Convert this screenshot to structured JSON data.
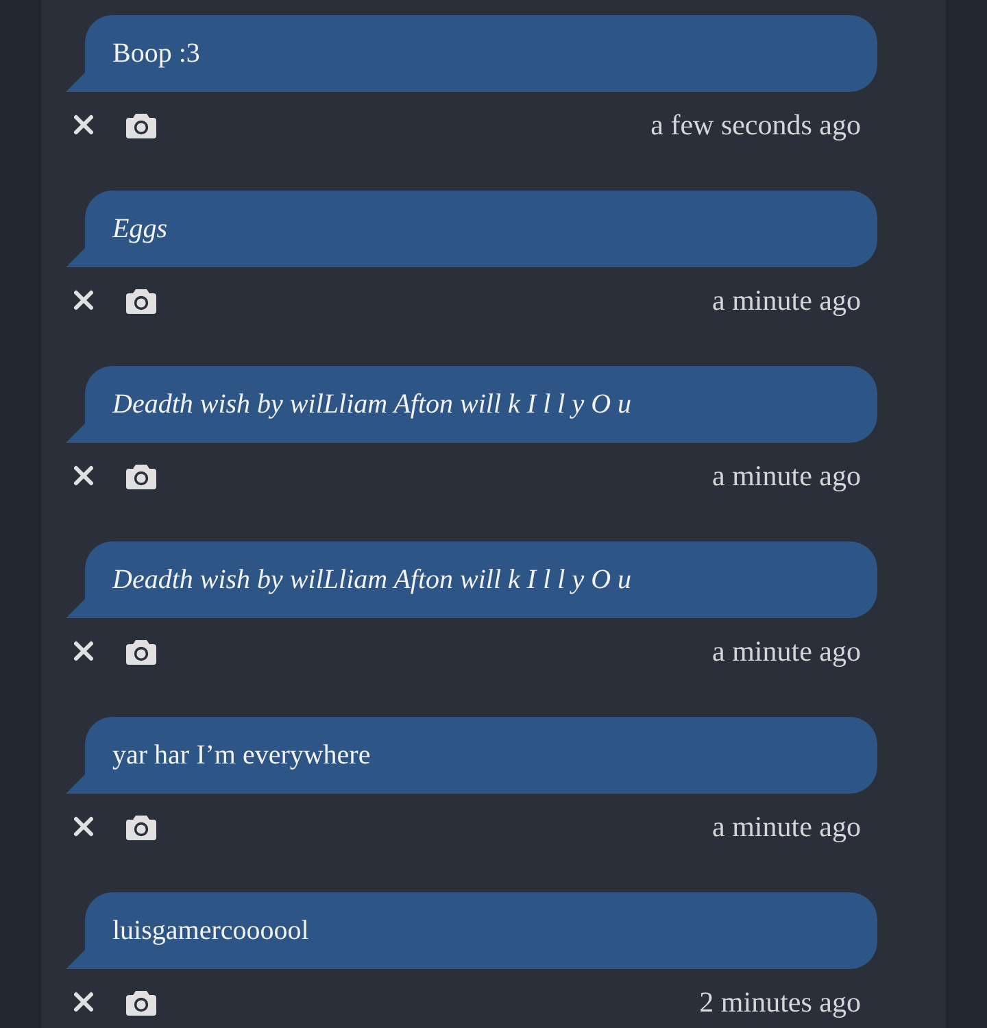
{
  "messages": [
    {
      "text": "Boop :3",
      "italic": false,
      "time": "a few seconds ago"
    },
    {
      "text": "Eggs",
      "italic": true,
      "time": "a minute ago"
    },
    {
      "text": "Deadth wish by wilLliam Afton will k I l l y O u",
      "italic": true,
      "time": "a minute ago"
    },
    {
      "text": "Deadth wish by wilLliam Afton will k I l l y O u",
      "italic": true,
      "time": "a minute ago"
    },
    {
      "text": "yar har I’m everywhere",
      "italic": false,
      "time": "a minute ago"
    },
    {
      "text": "luisgamercoooool",
      "italic": false,
      "time": "2 minutes ago"
    }
  ]
}
